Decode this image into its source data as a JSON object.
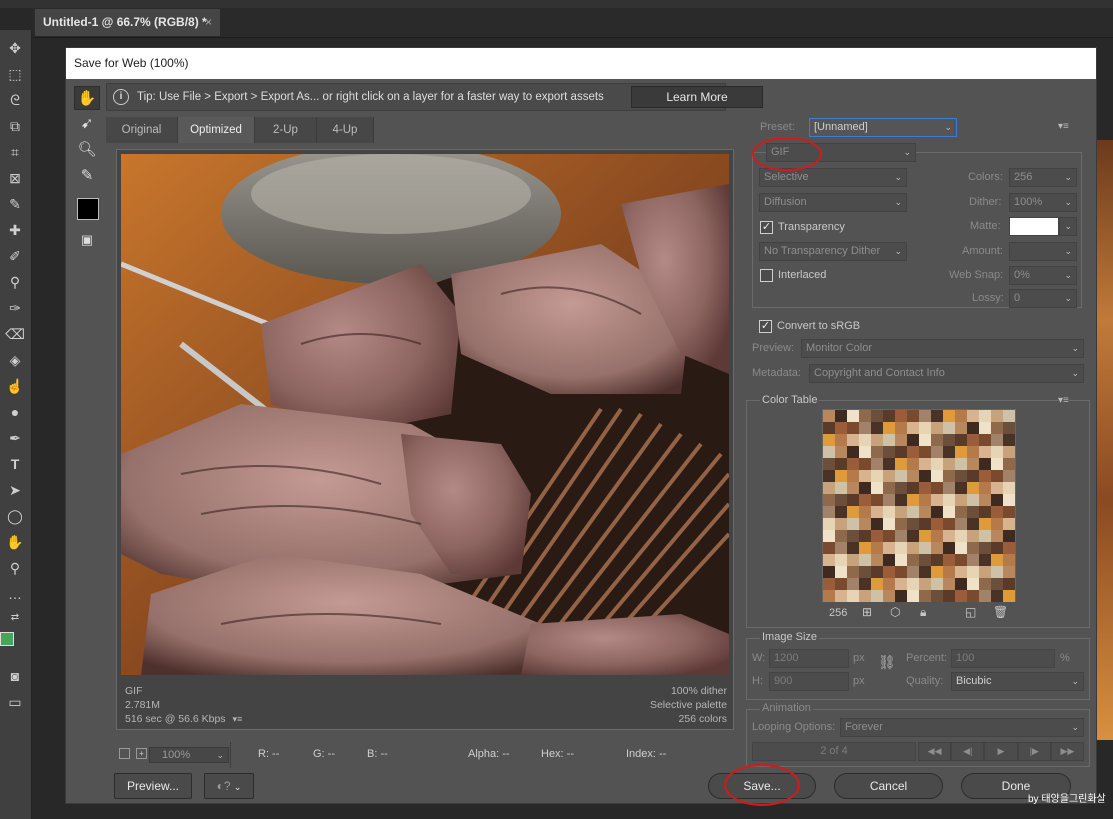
{
  "document_tab": {
    "title": "Untitled-1 @ 66.7% (RGB/8) *",
    "close": "×"
  },
  "dialog": {
    "title": "Save for Web (100%)",
    "tip": {
      "icon": "info-icon",
      "text": "Tip: Use File > Export > Export As...  or right click on a layer for a faster way to export assets",
      "learn_more": "Learn More"
    },
    "tools": [
      "hand-icon",
      "slice-select-icon",
      "zoom-icon",
      "eyedropper-icon",
      "color-swatch",
      "toggle-slices-icon"
    ],
    "view_tabs": [
      "Original",
      "Optimized",
      "2-Up",
      "4-Up"
    ],
    "active_tab": "Optimized",
    "image_info_left": [
      "GIF",
      "2.781M",
      "516 sec @ 56.6 Kbps"
    ],
    "image_info_right": [
      "100% dither",
      "Selective palette",
      "256 colors"
    ],
    "status": {
      "zoom": "100%",
      "r": "R: --",
      "g": "G: --",
      "b": "B: --",
      "alpha": "Alpha: --",
      "hex": "Hex: --",
      "index": "Index: --"
    },
    "buttons": {
      "preview": "Preview...",
      "save": "Save...",
      "cancel": "Cancel",
      "done": "Done"
    }
  },
  "settings": {
    "preset_label": "Preset:",
    "preset_value": "[Unnamed]",
    "format": "GIF",
    "reduction": "Selective",
    "dither_algo": "Diffusion",
    "transparency_label": "Transparency",
    "transparency_checked": true,
    "transparency_dither": "No Transparency Dither",
    "interlaced_label": "Interlaced",
    "interlaced_checked": false,
    "colors_label": "Colors:",
    "colors_value": "256",
    "dither_label": "Dither:",
    "dither_value": "100%",
    "matte_label": "Matte:",
    "amount_label": "Amount:",
    "websnap_label": "Web Snap:",
    "websnap_value": "0%",
    "lossy_label": "Lossy:",
    "lossy_value": "0",
    "convert_srgb_label": "Convert to sRGB",
    "convert_srgb_checked": true,
    "preview_label": "Preview:",
    "preview_value": "Monitor Color",
    "metadata_label": "Metadata:",
    "metadata_value": "Copyright and Contact Info"
  },
  "color_table": {
    "title": "Color Table",
    "count": "256",
    "swatches": [
      "#b9875e",
      "#7a4a2e",
      "#c8a27a",
      "#5a3b2a",
      "#d7b38f",
      "#8f6a4a",
      "#e09a3a",
      "#3e2a20",
      "#a3826a",
      "#cfc1a6",
      "#9b5c3a",
      "#e7d4b5",
      "#6b4f3b",
      "#b57a4a",
      "#f0e2c8",
      "#4a3326"
    ]
  },
  "image_size": {
    "title": "Image Size",
    "w_label": "W:",
    "w_value": "1200",
    "w_unit": "px",
    "h_label": "H:",
    "h_value": "900",
    "h_unit": "px",
    "percent_label": "Percent:",
    "percent_value": "100",
    "percent_unit": "%",
    "quality_label": "Quality:",
    "quality_value": "Bicubic"
  },
  "animation": {
    "title": "Animation",
    "looping_label": "Looping Options:",
    "looping_value": "Forever",
    "frame": "2 of 4",
    "controls": [
      "◀◀",
      "◀|",
      "▶",
      "|▶",
      "▶▶"
    ]
  },
  "watermark": "by 태양을그린화살"
}
